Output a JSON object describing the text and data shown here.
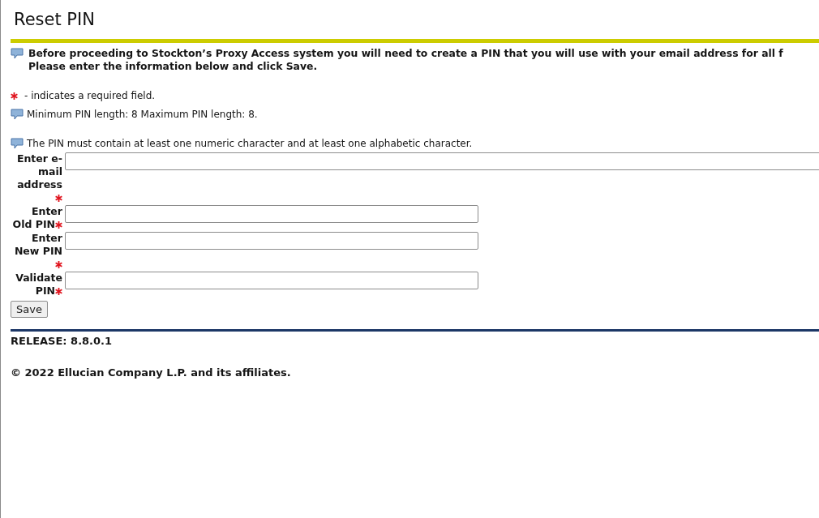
{
  "title": "Reset PIN",
  "intro": [
    "Before proceeding to Stockton’s Proxy Access system you will need to create a PIN that you will use with your email address for all f",
    "Please enter the information below and click Save."
  ],
  "required_legend": "- indicates a required field.",
  "notes": [
    "Minimum PIN length: 8 Maximum PIN length: 8.",
    "The PIN must contain at least one numeric character and at least one alphabetic character."
  ],
  "fields": [
    {
      "label": "Enter e-mail address",
      "kind": "email",
      "required": true
    },
    {
      "label": "Enter Old PIN",
      "kind": "pin",
      "required": true
    },
    {
      "label": "Enter New PIN",
      "kind": "pin",
      "required": true
    },
    {
      "label": "Validate PIN",
      "kind": "pin",
      "required": true
    }
  ],
  "save_button": "Save",
  "release": "RELEASE: 8.8.0.1",
  "copyright": "© 2022 Ellucian Company L.P. and its affiliates."
}
